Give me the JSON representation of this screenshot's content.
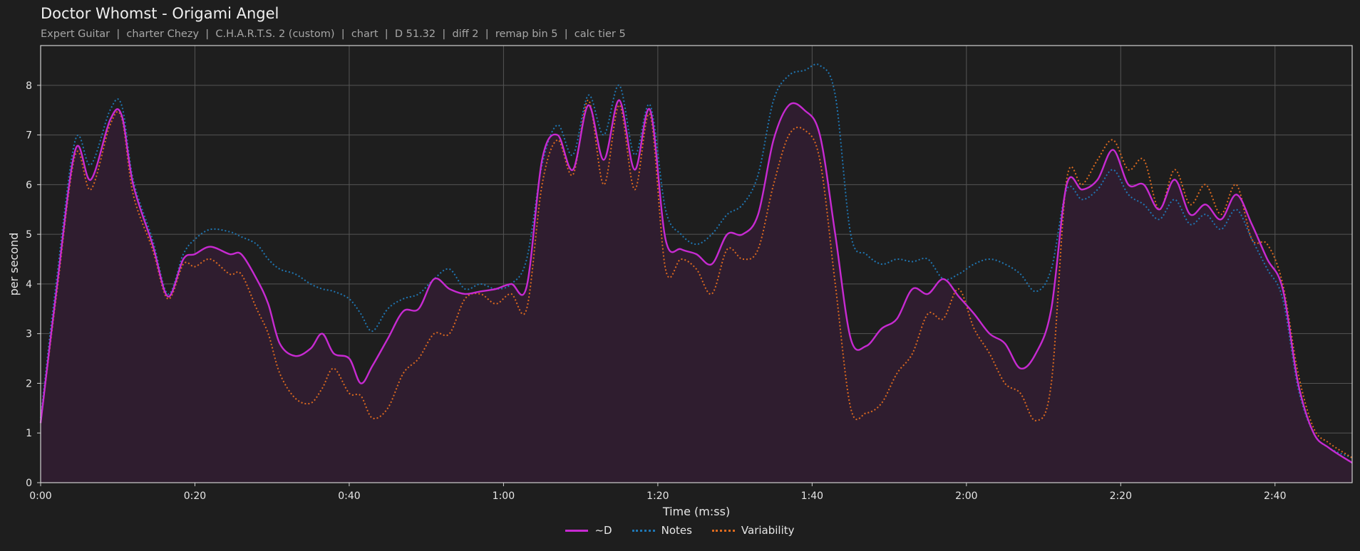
{
  "header": {
    "title": "Doctor Whomst - Origami Angel",
    "subtitle": "Expert Guitar  |  charter Chezy  |  C.H.A.R.T.S. 2 (custom)  |  chart  |  D 51.32  |  diff 2  |  remap bin 5  |  calc tier 5"
  },
  "colors": {
    "background": "#1e1e1e",
    "plot_border": "#d0d0d0",
    "grid": "#555555",
    "d": "#c72ad1",
    "notes": "#1f77b4",
    "variability": "#dd6a1f",
    "fill": "#2f1d2f"
  },
  "chart_data": {
    "type": "line",
    "xlabel": "Time (m:ss)",
    "ylabel": "per second",
    "xlim": [
      0,
      170
    ],
    "ylim": [
      0,
      8.8
    ],
    "grid": true,
    "legend_position": "bottom-center",
    "x_ticks": [
      0,
      20,
      40,
      60,
      80,
      100,
      120,
      140,
      160
    ],
    "x_tick_labels": [
      "0:00",
      "0:20",
      "0:40",
      "1:00",
      "1:20",
      "1:40",
      "2:00",
      "2:20",
      "2:40"
    ],
    "y_ticks": [
      0,
      1,
      2,
      3,
      4,
      5,
      6,
      7,
      8
    ],
    "y_tick_labels": [
      "0",
      "1",
      "2",
      "3",
      "4",
      "5",
      "6",
      "7",
      "8"
    ],
    "x": [
      0,
      2,
      4.5,
      6.5,
      9,
      10.5,
      12,
      14.5,
      16.5,
      18.5,
      20,
      22,
      24.5,
      26,
      28,
      29.5,
      31,
      33,
      35,
      36.5,
      38,
      40,
      41.5,
      43,
      45,
      47,
      49,
      51,
      53,
      55,
      57,
      59,
      61,
      63,
      65,
      67,
      69,
      71,
      73,
      75,
      77,
      79,
      81,
      83,
      85,
      87,
      89,
      91,
      93,
      95,
      97,
      99,
      101,
      103,
      105,
      107,
      109,
      111,
      113,
      115,
      117,
      119,
      121,
      123,
      125,
      127,
      129,
      131,
      133,
      135,
      137,
      139,
      141,
      143,
      145,
      147,
      149,
      151,
      153,
      155,
      157,
      159,
      161,
      163,
      165,
      167,
      170
    ],
    "series": [
      {
        "name": "~D",
        "values": [
          1.2,
          3.8,
          6.7,
          6.1,
          7.3,
          7.4,
          6.0,
          4.8,
          3.75,
          4.5,
          4.6,
          4.75,
          4.6,
          4.6,
          4.1,
          3.6,
          2.8,
          2.55,
          2.7,
          3.0,
          2.6,
          2.5,
          2.0,
          2.35,
          2.9,
          3.45,
          3.5,
          4.1,
          3.9,
          3.8,
          3.85,
          3.9,
          4.0,
          3.95,
          6.5,
          7.0,
          6.3,
          7.6,
          6.5,
          7.7,
          6.3,
          7.5,
          4.9,
          4.7,
          4.6,
          4.4,
          5.0,
          5.0,
          5.4,
          6.9,
          7.6,
          7.5,
          7.0,
          5.0,
          2.9,
          2.75,
          3.1,
          3.3,
          3.9,
          3.8,
          4.1,
          3.75,
          3.4,
          3.0,
          2.8,
          2.3,
          2.6,
          3.5,
          6.0,
          5.9,
          6.1,
          6.7,
          6.0,
          6.0,
          5.5,
          6.1,
          5.4,
          5.6,
          5.3,
          5.8,
          5.2,
          4.5,
          3.9,
          2.0,
          1.0,
          0.7,
          0.4
        ]
      },
      {
        "name": "Notes",
        "values": [
          1.3,
          4.0,
          6.9,
          6.4,
          7.5,
          7.6,
          6.1,
          4.9,
          3.8,
          4.6,
          4.9,
          5.1,
          5.05,
          4.95,
          4.8,
          4.5,
          4.3,
          4.2,
          4.0,
          3.9,
          3.85,
          3.7,
          3.4,
          3.05,
          3.5,
          3.7,
          3.8,
          4.1,
          4.3,
          3.9,
          4.0,
          3.9,
          4.0,
          4.5,
          6.4,
          7.2,
          6.6,
          7.8,
          7.0,
          8.0,
          6.6,
          7.6,
          5.5,
          5.0,
          4.8,
          5.0,
          5.4,
          5.6,
          6.2,
          7.7,
          8.2,
          8.3,
          8.4,
          7.8,
          5.0,
          4.6,
          4.4,
          4.5,
          4.45,
          4.5,
          4.1,
          4.2,
          4.4,
          4.5,
          4.4,
          4.2,
          3.85,
          4.3,
          5.9,
          5.7,
          5.9,
          6.3,
          5.8,
          5.6,
          5.3,
          5.7,
          5.2,
          5.4,
          5.1,
          5.5,
          4.9,
          4.3,
          3.7,
          1.9,
          1.0,
          0.7,
          0.5
        ]
      },
      {
        "name": "Variability",
        "values": [
          1.2,
          3.7,
          6.6,
          5.9,
          7.2,
          7.35,
          5.8,
          4.7,
          3.7,
          4.4,
          4.35,
          4.5,
          4.2,
          4.2,
          3.5,
          3.0,
          2.2,
          1.7,
          1.6,
          1.9,
          2.3,
          1.8,
          1.75,
          1.3,
          1.5,
          2.2,
          2.5,
          3.0,
          3.0,
          3.7,
          3.8,
          3.6,
          3.8,
          3.5,
          6.0,
          6.9,
          6.2,
          7.7,
          6.0,
          7.6,
          5.9,
          7.4,
          4.3,
          4.5,
          4.3,
          3.8,
          4.7,
          4.5,
          4.7,
          6.0,
          7.0,
          7.1,
          6.5,
          4.0,
          1.5,
          1.4,
          1.6,
          2.2,
          2.6,
          3.4,
          3.3,
          3.9,
          3.1,
          2.6,
          2.0,
          1.8,
          1.25,
          2.0,
          6.1,
          6.0,
          6.5,
          6.9,
          6.3,
          6.5,
          5.5,
          6.3,
          5.6,
          6.0,
          5.4,
          6.0,
          4.9,
          4.8,
          4.0,
          2.2,
          1.1,
          0.8,
          0.5
        ]
      }
    ]
  }
}
